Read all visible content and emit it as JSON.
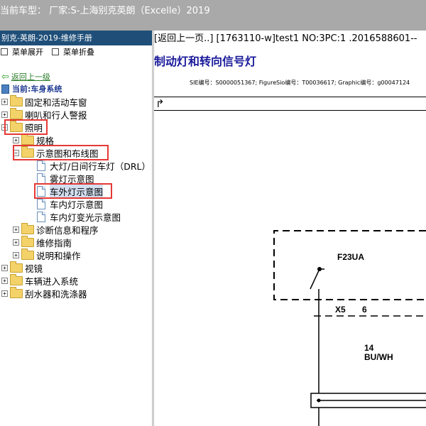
{
  "window": {
    "title": "当前车型：  厂家:S-上海别克英朗（Excelle）2019"
  },
  "sidebar": {
    "header": "别克-英朗-2019-维修手册",
    "expand_all": "菜单展开",
    "collapse_all": "菜单折叠",
    "back_link": "返回上一级",
    "current": "当前:车身系统",
    "items": [
      {
        "label": "固定和活动车窗"
      },
      {
        "label": "喇叭和行人警报"
      },
      {
        "label": "照明"
      },
      {
        "label": "规格"
      },
      {
        "label": "示意图和布线图"
      },
      {
        "label": "大灯/日间行车灯（DRL）"
      },
      {
        "label": "雾灯示意图"
      },
      {
        "label": "车外灯示意图"
      },
      {
        "label": "车内灯示意图"
      },
      {
        "label": "车内灯变光示意图"
      },
      {
        "label": "诊断信息和程序"
      },
      {
        "label": "维修指南"
      },
      {
        "label": "说明和操作"
      },
      {
        "label": "视镜"
      },
      {
        "label": "车辆进入系统"
      },
      {
        "label": "刮水器和洗涤器"
      }
    ]
  },
  "content": {
    "breadcrumb": "[返回上一页..] [1763110-w]test1 NO:3PC:1 .2016588601--",
    "title": "制动灯和转向信号灯",
    "ids": "SIE编号：S0000051367;  FigureSio编号：T00036617;  Graphic编号：g00047124",
    "diagram": {
      "component": "F23UA",
      "connector": "X5",
      "pin": "6",
      "wire_gauge": "14",
      "wire_color": "BU/WH"
    }
  }
}
